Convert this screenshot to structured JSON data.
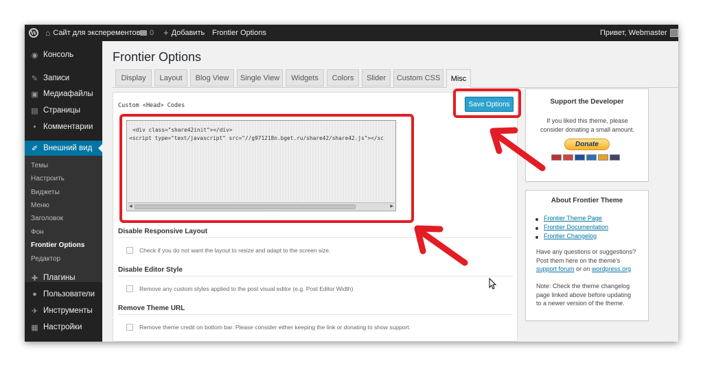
{
  "admin_bar": {
    "site_name": "Сайт для эксперементов",
    "comments_count": "0",
    "add_new_label": "Добавить",
    "theme_link": "Frontier Options",
    "greeting": "Привет, Webmaster"
  },
  "sidebar": {
    "items": [
      {
        "label": "Консоль",
        "icon": "dashboard-icon",
        "glyph": "◉"
      },
      {
        "label": "Записи",
        "icon": "pin-icon",
        "glyph": "✎"
      },
      {
        "label": "Медиафайлы",
        "icon": "media-icon",
        "glyph": "▣"
      },
      {
        "label": "Страницы",
        "icon": "pages-icon",
        "glyph": "▤"
      },
      {
        "label": "Комментарии",
        "icon": "comments-icon",
        "glyph": "▪"
      },
      {
        "label": "Внешний вид",
        "icon": "appearance-icon",
        "glyph": "✐"
      },
      {
        "label": "Плагины",
        "icon": "plugins-icon",
        "glyph": "✚"
      },
      {
        "label": "Пользователи",
        "icon": "users-icon",
        "glyph": "●"
      },
      {
        "label": "Инструменты",
        "icon": "tools-icon",
        "glyph": "✈"
      },
      {
        "label": "Настройки",
        "icon": "settings-icon",
        "glyph": "▦"
      }
    ],
    "submenu": [
      "Темы",
      "Настроить",
      "Виджеты",
      "Меню",
      "Заголовок",
      "Фон",
      "Frontier Options",
      "Редактор"
    ]
  },
  "page_title": "Frontier Options",
  "tabs": [
    "Display",
    "Layout",
    "Blog View",
    "Single View",
    "Widgets",
    "Colors",
    "Slider",
    "Custom CSS",
    "Misc"
  ],
  "options": {
    "code_label": "Custom <Head> Codes",
    "save_label": "Save Options",
    "code_lines": [
      "<div class=\"share42init\"></div>",
      "<script type=\"text/javascript\" src=\"//g971218n.bget.ru/share42/share42.js\"></sc"
    ],
    "sections": [
      {
        "title": "Disable Responsive Layout",
        "option": "Check if you do not want the layout to resize and adapt to the screen size."
      },
      {
        "title": "Disable Editor Style",
        "option": "Remove any custom styles applied to the post visual editor (e.g. Post Editor Width)"
      },
      {
        "title": "Remove Theme URL",
        "option": "Remove theme credit on bottom bar. Please consider either keeping the link or donating to show support."
      }
    ]
  },
  "support_widget": {
    "title": "Support the Developer",
    "text_line1": "If you liked this theme, please",
    "text_line2": "consider donating a small amount.",
    "donate_label": "Donate"
  },
  "about_widget": {
    "title": "About Frontier Theme",
    "links": [
      "Frontier Theme Page",
      "Frontier Documentation",
      "Frontier Changelog"
    ],
    "q_line1": "Have any questions or suggestions?",
    "q_line2": "Post them here on the theme's",
    "support_forum": "support forum",
    "or_on": " or on ",
    "wordpress_link": "wordpress.org",
    "note_line1": "Note: Check the theme changelog",
    "note_line2": "page linked above before updating",
    "note_line3": "to a newer version of the theme."
  },
  "colors": {
    "accent": "#0074a2",
    "button": "#2ea2cc",
    "annotation": "#e31d25",
    "admin_bar": "#222222"
  }
}
